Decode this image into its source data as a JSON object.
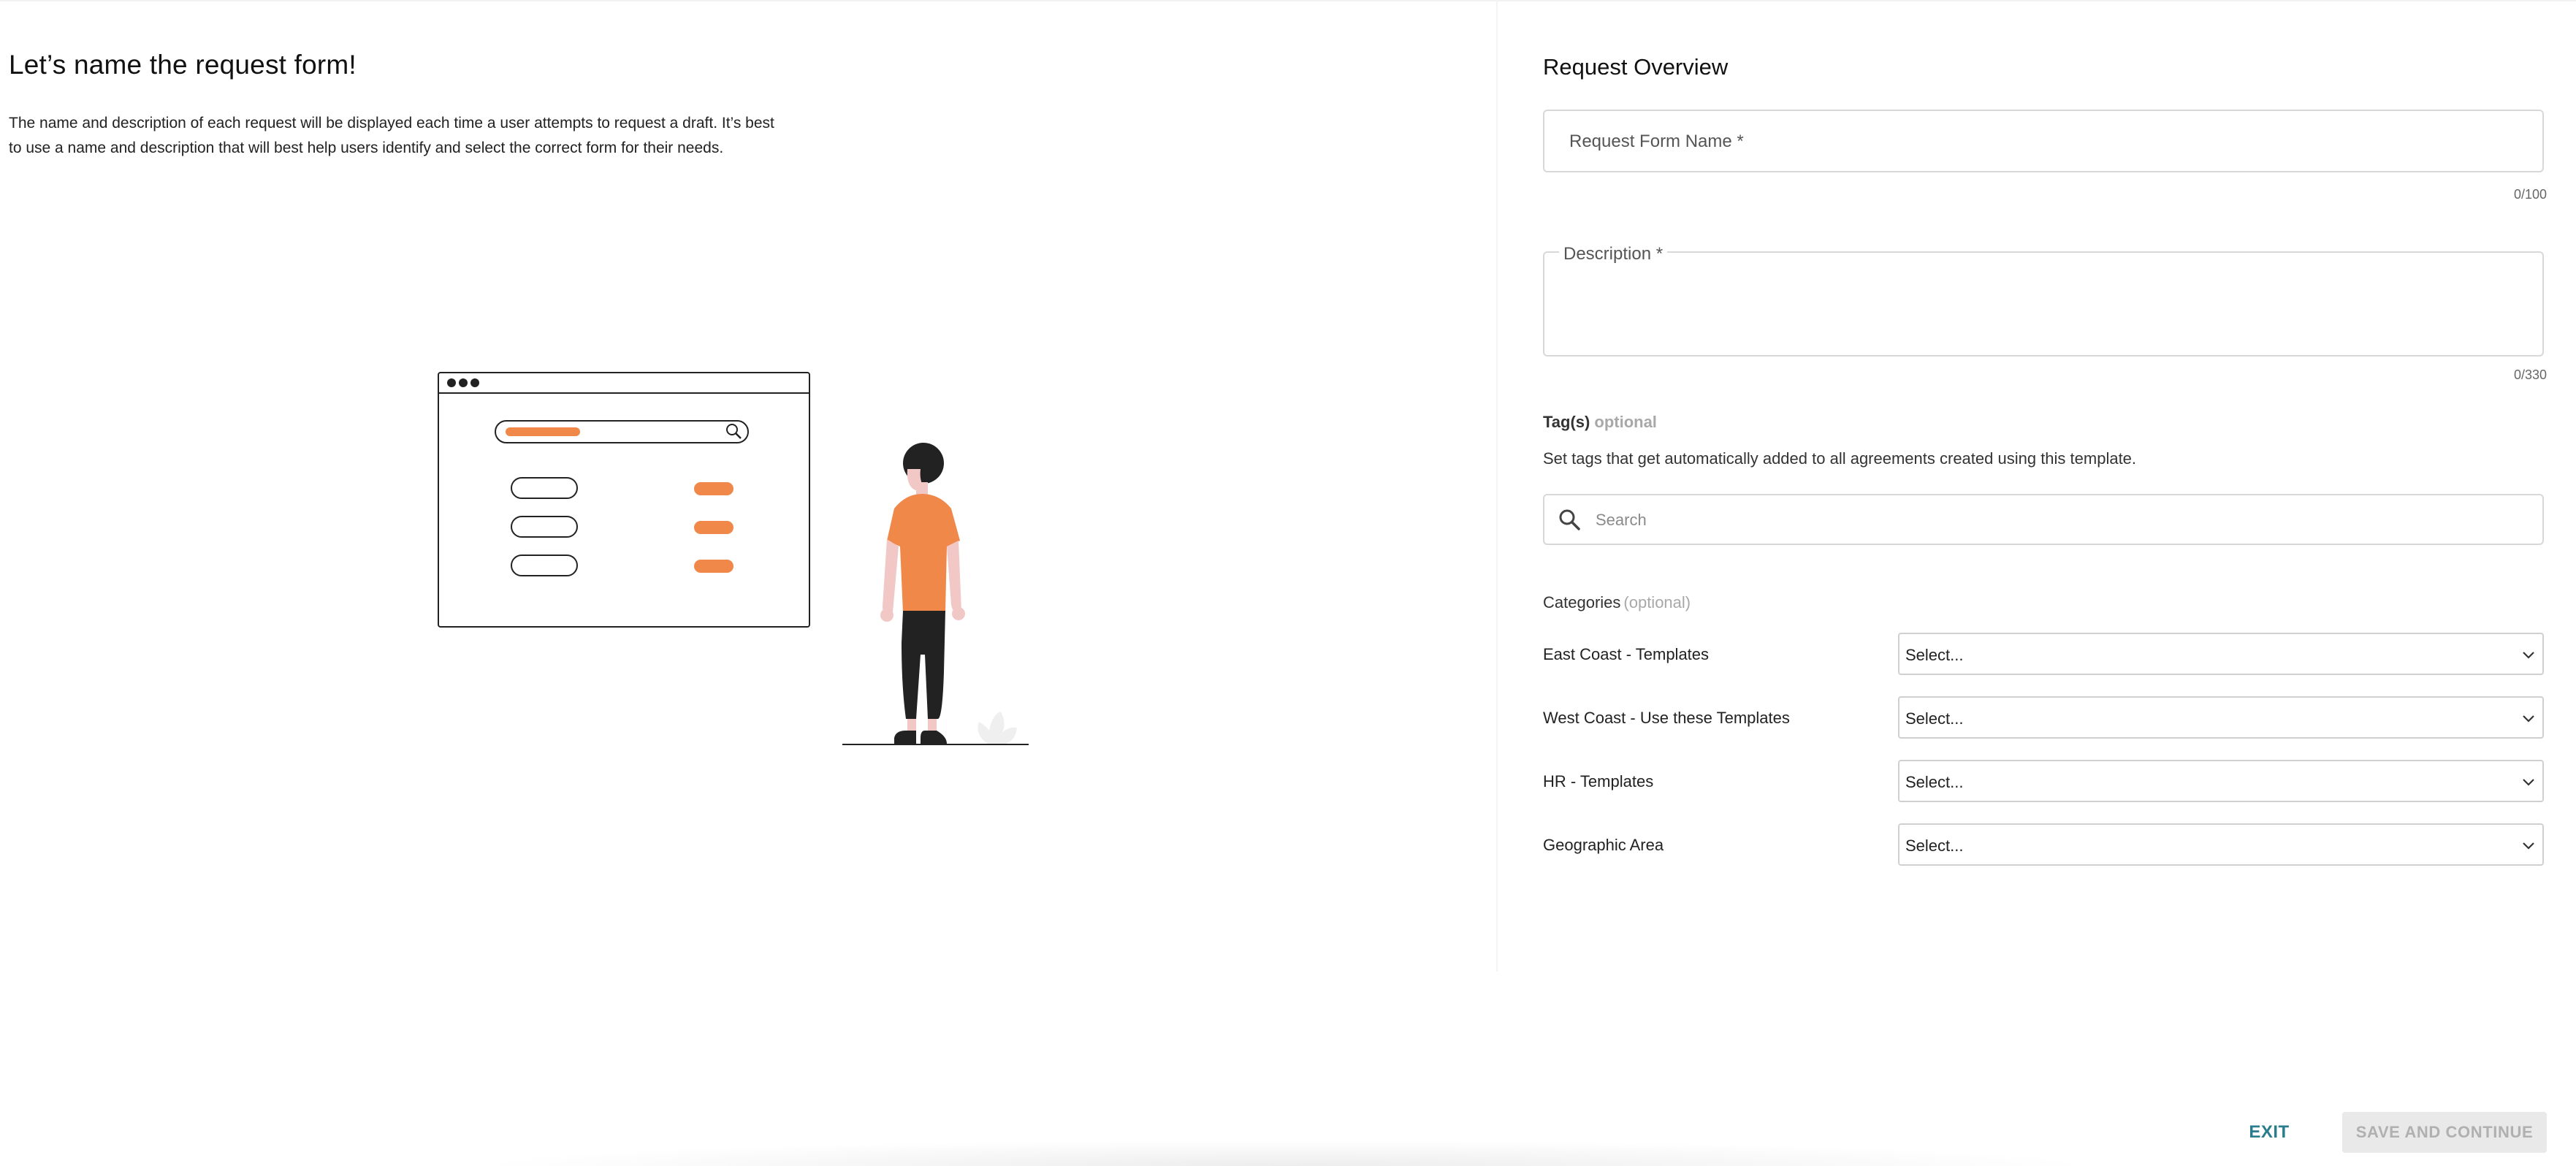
{
  "left": {
    "title": "Let’s name the request form!",
    "description": "The name and description of each request will be displayed each time a user attempts to request a draft. It’s best to use a name and description that will best help users identify and select the correct form for their needs."
  },
  "overview": {
    "title": "Request Overview",
    "name_field": {
      "label": "Request Form Name *",
      "value": "",
      "counter": "0/100"
    },
    "description_field": {
      "label": "Description *",
      "value": "",
      "counter": "0/330"
    }
  },
  "tags": {
    "label": "Tag(s)",
    "optional": "optional",
    "help": "Set tags that get automatically added to all agreements created using this template.",
    "search": {
      "placeholder": "Search",
      "value": "",
      "icon": "search-icon"
    }
  },
  "categories": {
    "label": "Categories",
    "optional": "(optional)",
    "items": [
      {
        "label": "East Coast - Templates",
        "selected": "Select..."
      },
      {
        "label": "West Coast - Use these Templates",
        "selected": "Select..."
      },
      {
        "label": "HR - Templates",
        "selected": "Select..."
      },
      {
        "label": "Geographic Area",
        "selected": "Select..."
      }
    ]
  },
  "footer": {
    "exit_label": "EXIT",
    "save_label": "SAVE AND CONTINUE"
  },
  "colors": {
    "accent_orange": "#f0884a",
    "exit_teal": "#2a7d8c",
    "disabled_bg": "#e9e9e9",
    "disabled_text": "#b0b0b0"
  }
}
